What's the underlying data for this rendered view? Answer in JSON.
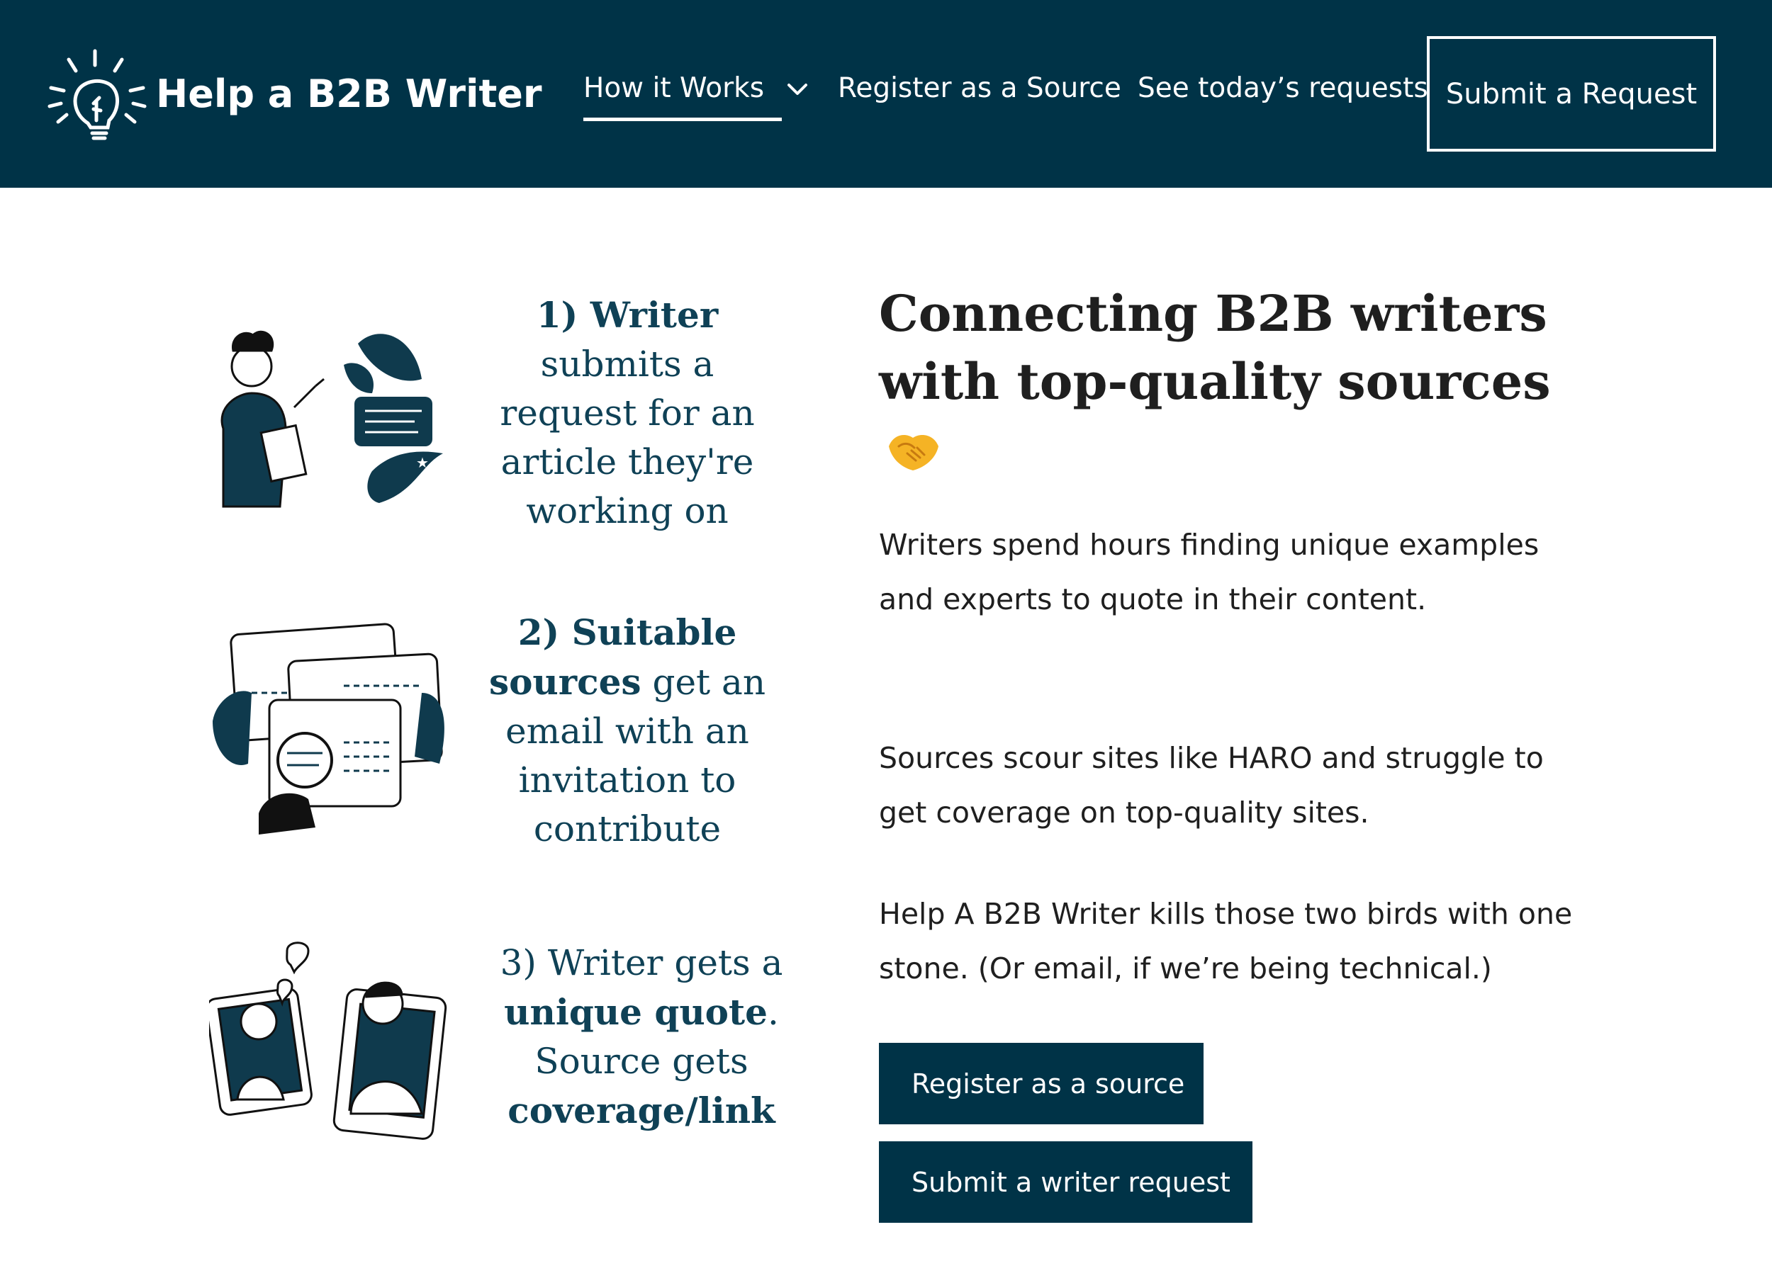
{
  "brand": {
    "name": "Help a B2B Writer",
    "primary_color": "#003347",
    "accent_color": "#0f4156"
  },
  "nav": {
    "items": [
      {
        "label": "How it Works",
        "icon": "chevron-down-icon",
        "active": true
      },
      {
        "label": "Register as a Source"
      },
      {
        "label": "See today’s requests"
      }
    ],
    "cta_label": "Submit a Request"
  },
  "steps": [
    {
      "number": "1)",
      "bold": "Writer",
      "rest": "submits a request for an article they're working on",
      "illustration": "writer-clipboard-illustration"
    },
    {
      "number": "2)",
      "bold_a": "Suitable",
      "bold_b": "sources",
      "rest": "get an email with an invitation to contribute",
      "illustration": "browser-windows-magnifier-illustration"
    },
    {
      "line1": "3) Writer gets a",
      "bold_a": "unique quote",
      "after_bold_a": ".",
      "line3": "Source gets",
      "bold_b": "coverage/link",
      "illustration": "video-call-illustration"
    }
  ],
  "hero": {
    "title": "Connecting B2B writers with top-quality sources",
    "emoji": "handshake-icon",
    "paragraphs": [
      "Writers spend hours finding unique examples and experts to quote in their content.",
      "Sources scour sites like HARO and struggle to get coverage on top-quality sites.",
      "Help A B2B Writer kills those two birds with one stone. (Or email, if we’re being technical.)"
    ],
    "buttons": {
      "register": "Register as a source",
      "submit": "Submit a writer request"
    }
  }
}
